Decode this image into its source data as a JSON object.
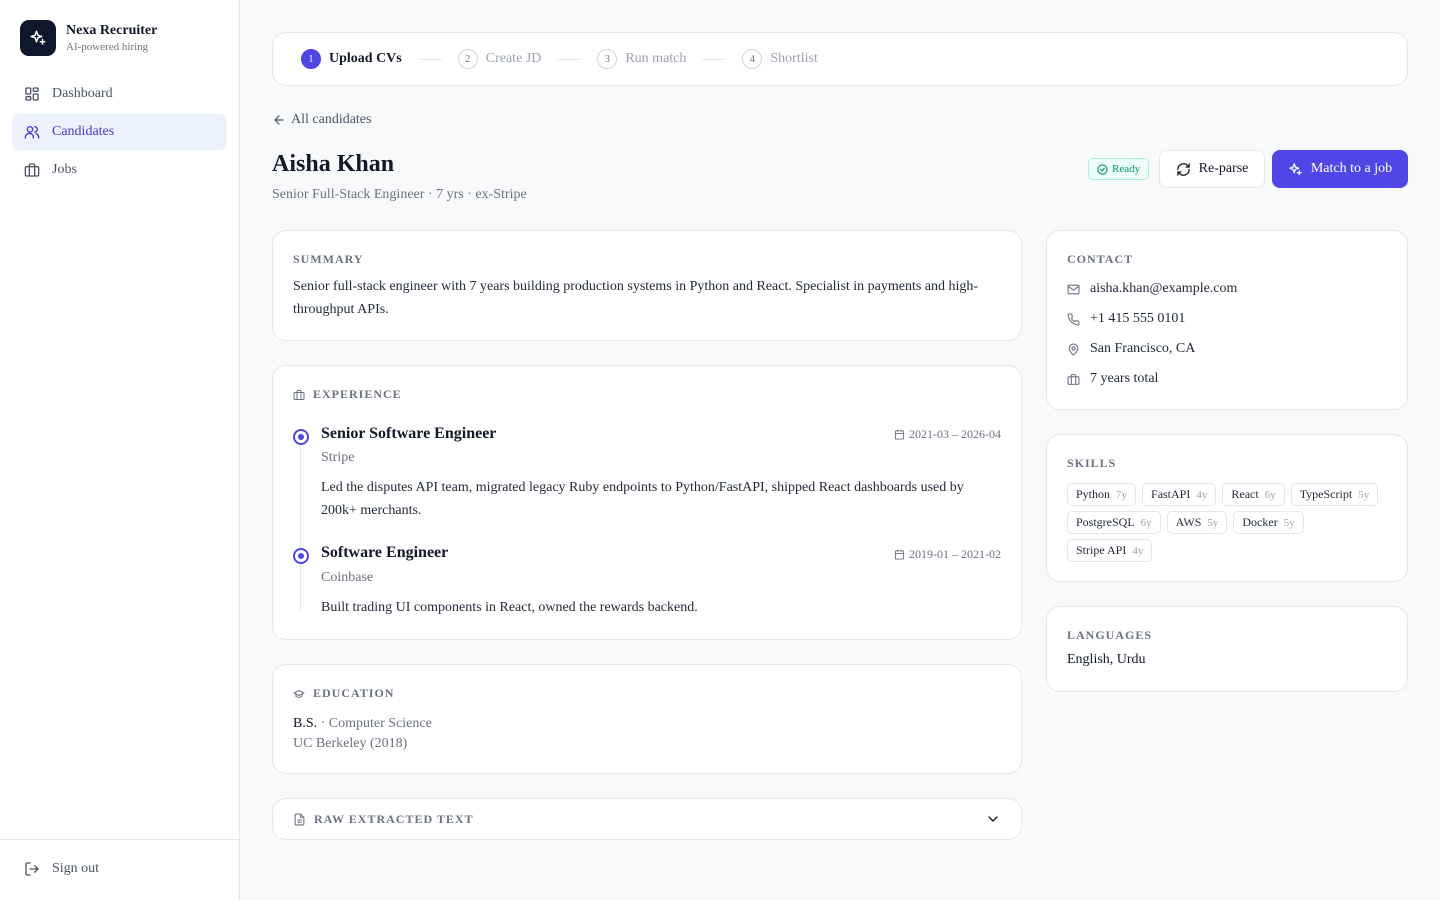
{
  "brand": {
    "name": "Nexa Recruiter",
    "tagline": "AI-powered hiring"
  },
  "nav": {
    "items": [
      {
        "label": "Dashboard",
        "icon": "dashboard-icon"
      },
      {
        "label": "Candidates",
        "icon": "users-icon",
        "active": true
      },
      {
        "label": "Jobs",
        "icon": "briefcase-icon"
      }
    ],
    "sign_out": "Sign out"
  },
  "stepper": {
    "steps": [
      {
        "num": "1",
        "label": "Upload CVs",
        "active": true
      },
      {
        "num": "2",
        "label": "Create JD"
      },
      {
        "num": "3",
        "label": "Run match"
      },
      {
        "num": "4",
        "label": "Shortlist"
      }
    ]
  },
  "back_link": "All candidates",
  "candidate": {
    "name": "Aisha Khan",
    "subtitle": "Senior Full-Stack Engineer · 7 yrs · ex-Stripe",
    "status": "Ready"
  },
  "actions": {
    "reparse": "Re-parse",
    "match": "Match to a job"
  },
  "summary": {
    "heading": "SUMMARY",
    "text": "Senior full-stack engineer with 7 years building production systems in Python and React. Specialist in payments and high-throughput APIs."
  },
  "experience": {
    "heading": "EXPERIENCE",
    "jobs": [
      {
        "title": "Senior Software Engineer",
        "company": "Stripe",
        "dates": "2021-03 – 2026-04",
        "description": "Led the disputes API team, migrated legacy Ruby endpoints to Python/FastAPI, shipped React dashboards used by 200k+ merchants."
      },
      {
        "title": "Software Engineer",
        "company": "Coinbase",
        "dates": "2019-01 – 2021-02",
        "description": "Built trading UI components in React, owned the rewards backend."
      }
    ]
  },
  "education": {
    "heading": "EDUCATION",
    "degree": "B.S.",
    "separator": " · ",
    "field": "Computer Science",
    "school": "UC Berkeley (2018)"
  },
  "raw_text": {
    "heading": "RAW EXTRACTED TEXT"
  },
  "contact": {
    "heading": "CONTACT",
    "email": "aisha.khan@example.com",
    "phone": "+1 415 555 0101",
    "location": "San Francisco, CA",
    "experience_total": "7 years total"
  },
  "skills": {
    "heading": "SKILLS",
    "items": [
      {
        "name": "Python",
        "years": "7y"
      },
      {
        "name": "FastAPI",
        "years": "4y"
      },
      {
        "name": "React",
        "years": "6y"
      },
      {
        "name": "TypeScript",
        "years": "5y"
      },
      {
        "name": "PostgreSQL",
        "years": "6y"
      },
      {
        "name": "AWS",
        "years": "5y"
      },
      {
        "name": "Docker",
        "years": "5y"
      },
      {
        "name": "Stripe API",
        "years": "4y"
      }
    ]
  },
  "languages": {
    "heading": "LANGUAGES",
    "text": "English, Urdu"
  },
  "colors": {
    "accent": "#4f46e5",
    "success": "#059669",
    "sidebar_active_bg": "#eef0fb"
  }
}
